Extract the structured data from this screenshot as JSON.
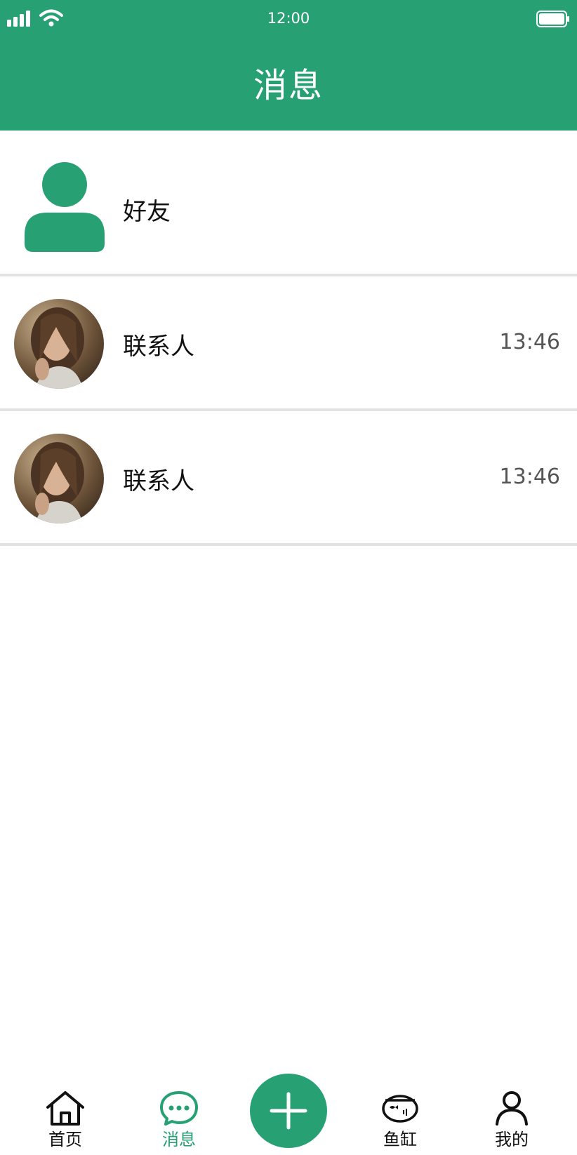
{
  "status_bar": {
    "time": "12:00"
  },
  "header": {
    "title": "消息"
  },
  "friends_row": {
    "label": "好友",
    "icon": "person-icon"
  },
  "contacts": [
    {
      "name": "联系人",
      "time": "13:46",
      "avatar": "photo-avatar"
    },
    {
      "name": "联系人",
      "time": "13:46",
      "avatar": "photo-avatar"
    }
  ],
  "tabbar": {
    "home": "首页",
    "messages": "消息",
    "tank": "鱼缸",
    "mine": "我的",
    "add_icon": "plus-icon"
  },
  "colors": {
    "accent": "#27a174",
    "divider": "#e3e3e3"
  }
}
